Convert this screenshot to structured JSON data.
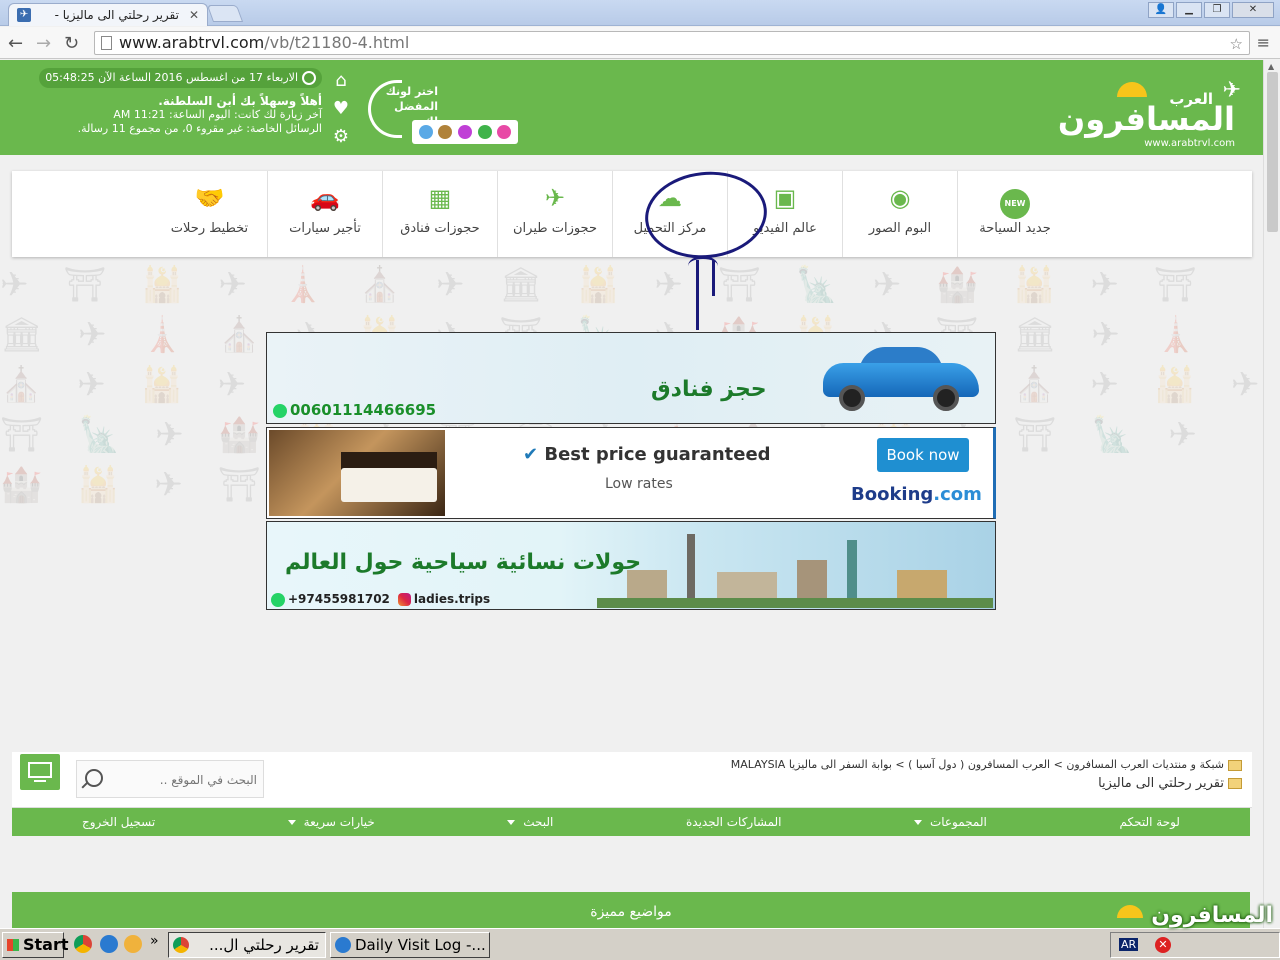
{
  "browser": {
    "tab_title": "تقرير رحلتي الى ماليزيا -",
    "url_host": "www.arabtrvl.com",
    "url_path": "/vb/t21180-4.html"
  },
  "header": {
    "datetime": "الاربعاء 17 من اغسطس 2016 الساعة الآن 05:48:25",
    "welcome": "أهلاً وسهلاً بك أبن السلطنة.",
    "last_visit": "آخر زيارة لك كانت: اليوم الساعة: 11:21 AM",
    "private_messages": "الرسائل الخاصة: غير مقروء 0، من مجموع 11 رسالة.",
    "theme_prompt": "اختر لونك المفضل لك",
    "theme_colors": [
      "#5aa9e6",
      "#b0823a",
      "#c03fd6",
      "#3fb34a",
      "#e84aa6"
    ],
    "logo_line1": "العرب",
    "logo_line2": "المسافرون",
    "logo_line3": "www.arabtrvl.com"
  },
  "nav": {
    "items": [
      {
        "label": "جديد السياحة",
        "icon": "new-badge-icon"
      },
      {
        "label": "البوم الصور",
        "icon": "eye-icon"
      },
      {
        "label": "عالم الفيديو",
        "icon": "video-camera-icon"
      },
      {
        "label": "مركز التحميل",
        "icon": "cloud-upload-icon"
      },
      {
        "label": "حجوزات طيران",
        "icon": "airplane-icon"
      },
      {
        "label": "حجوزات فنادق",
        "icon": "building-icon"
      },
      {
        "label": "تأجير سيارات",
        "icon": "car-icon"
      },
      {
        "label": "تخطيط رحلات",
        "icon": "handshake-icon"
      }
    ],
    "new_badge": "NEW"
  },
  "banners": {
    "hotel_booking": {
      "text": "حجز فنادق",
      "phone": "00601114466695"
    },
    "booking_ad": {
      "headline": "Best price guaranteed",
      "sub": "Low rates",
      "button": "Book now",
      "brand1": "Booking",
      "brand2": ".com"
    },
    "ladies_tours": {
      "text": "جولات نسائية سياحية حول العالم",
      "phone": "+97455981702",
      "instagram": "ladies.trips"
    }
  },
  "breadcrumb": {
    "path": "شبكة و منتديات العرب المسافرون > العرب المسافرون ( دول آسيا ) > بوابة السفر الى ماليزيا MALAYSIA",
    "title": "تقرير رحلتي الى ماليزيا",
    "search_placeholder": "البحث في الموقع .."
  },
  "menu_bar": {
    "items": [
      {
        "label": "لوحة التحكم",
        "dropdown": false
      },
      {
        "label": "المجموعات",
        "dropdown": true
      },
      {
        "label": "المشاركات الجديدة",
        "dropdown": false
      },
      {
        "label": "البحث",
        "dropdown": true
      },
      {
        "label": "خيارات سريعة",
        "dropdown": true
      },
      {
        "label": "تسجيل الخروج",
        "dropdown": false
      }
    ]
  },
  "featured": {
    "label": "مواضيع مميزة"
  },
  "taskbar": {
    "start": "Start",
    "tasks": [
      "تقرير رحلتي ال...",
      "Daily Visit Log -..."
    ],
    "chevron": "»",
    "lang": "AR",
    "watermark": "المسافرون"
  }
}
